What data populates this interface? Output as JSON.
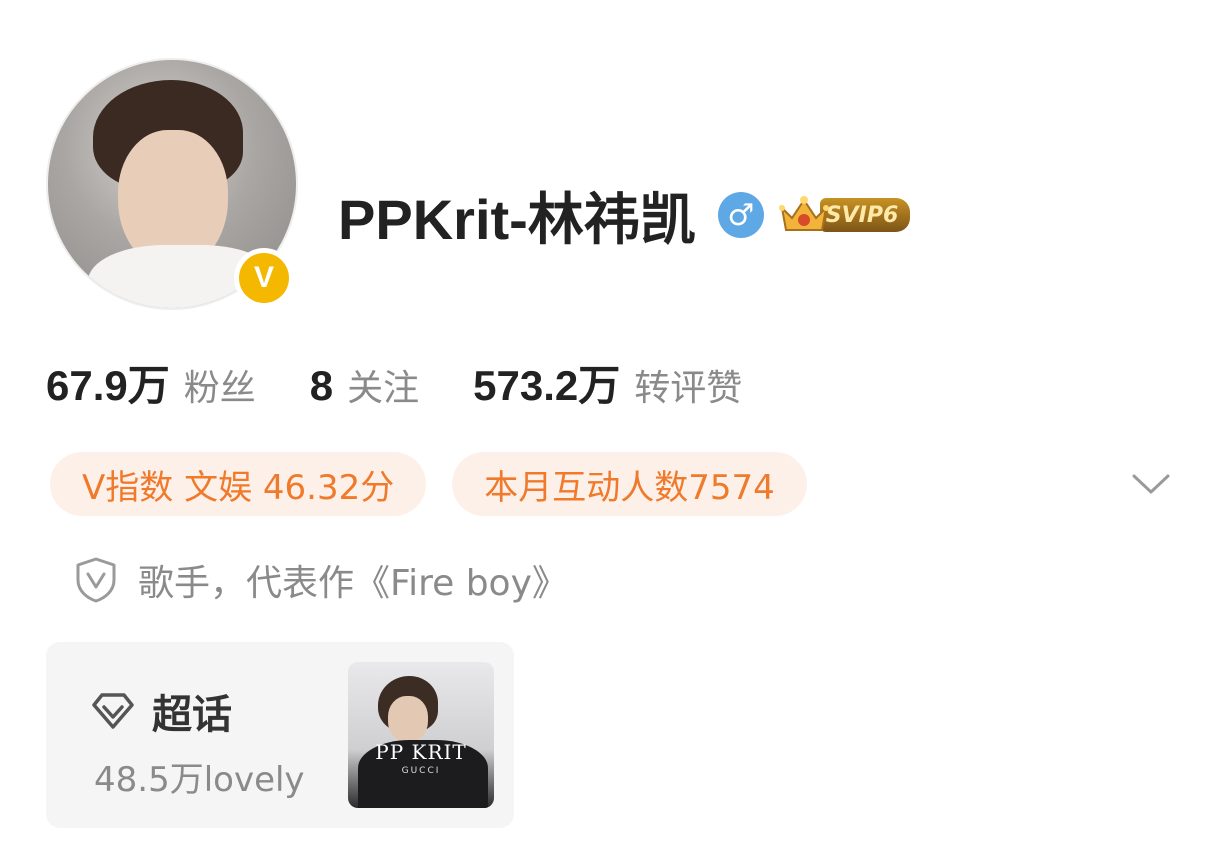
{
  "profile": {
    "name": "PPKrit-林祎凯",
    "gender_symbol": "♂",
    "verified_badge": "V",
    "svip_label": "SVIP6"
  },
  "stats": [
    {
      "value": "67.9万",
      "label": "粉丝"
    },
    {
      "value": "8",
      "label": "关注"
    },
    {
      "value": "573.2万",
      "label": "转评赞"
    }
  ],
  "tags": [
    {
      "text": "V指数 文娱 46.32分"
    },
    {
      "text": "本月互动人数7574"
    }
  ],
  "verification": {
    "text": "歌手，代表作《Fire boy》"
  },
  "supertopic": {
    "title": "超话",
    "subtitle": "48.5万lovely",
    "thumb_title": "PP KRIT",
    "thumb_sub": "GUCCI"
  },
  "colors": {
    "accent_orange": "#f07a2c",
    "tag_bg": "#fdf0e8",
    "gender_blue": "#5fa8e6",
    "verified_gold": "#f5b800"
  },
  "icons": {
    "expand": "chevron-down-icon",
    "verification": "shield-v-icon",
    "supertopic": "diamond-icon"
  }
}
